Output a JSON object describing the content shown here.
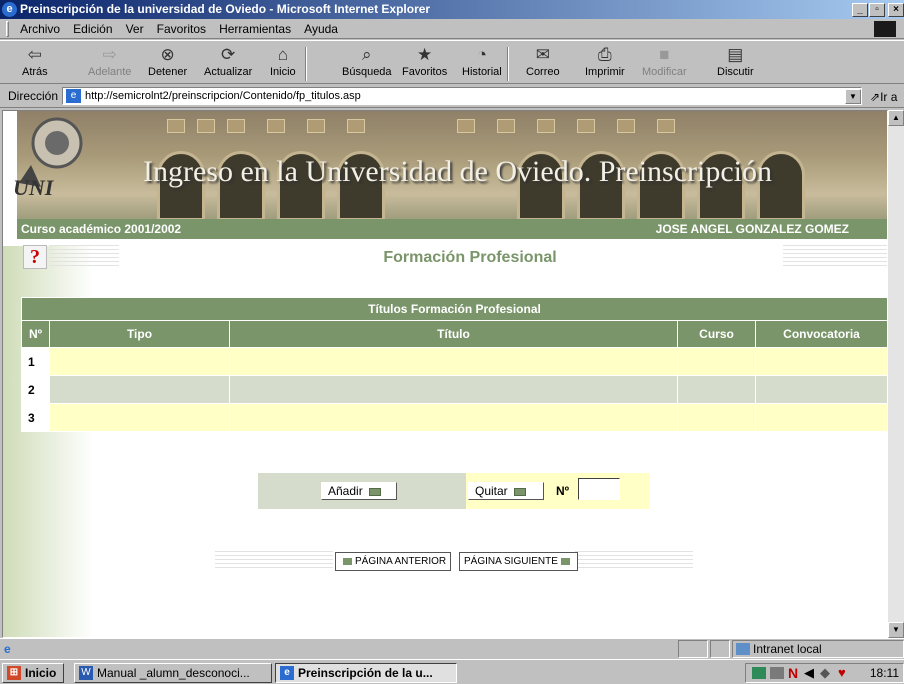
{
  "window": {
    "title": "Preinscripción de la universidad de Oviedo - Microsoft Internet Explorer"
  },
  "menu": [
    "Archivo",
    "Edición",
    "Ver",
    "Favoritos",
    "Herramientas",
    "Ayuda"
  ],
  "toolbar": {
    "back": "Atrás",
    "forward": "Adelante",
    "stop": "Detener",
    "refresh": "Actualizar",
    "home": "Inicio",
    "search": "Búsqueda",
    "favorites": "Favoritos",
    "history": "Historial",
    "mail": "Correo",
    "print": "Imprimir",
    "edit": "Modificar",
    "discuss": "Discutir"
  },
  "address": {
    "label": "Dirección",
    "url": "http://semicrolnt2/preinscripcion/Contenido/fp_titulos.asp",
    "go": "Ir a"
  },
  "banner": {
    "title": "Ingreso en la Universidad de Oviedo. Preinscripción",
    "course": "Curso académico 2001/2002",
    "user": "JOSE ANGEL GONZALEZ GOMEZ"
  },
  "section": {
    "title": "Formación Profesional"
  },
  "table": {
    "caption": "Títulos Formación Profesional",
    "headers": [
      "Nº",
      "Tipo",
      "Título",
      "Curso",
      "Convocatoria"
    ],
    "rows": [
      {
        "n": "1"
      },
      {
        "n": "2"
      },
      {
        "n": "3"
      }
    ]
  },
  "actions": {
    "add": "Añadir",
    "remove": "Quitar",
    "num_label": "Nº",
    "num_value": ""
  },
  "nav": {
    "prev": "PÁGINA ANTERIOR",
    "next": "PÁGINA SIGUIENTE"
  },
  "status": {
    "zone": "Intranet local"
  },
  "taskbar": {
    "start": "Inicio",
    "tasks": [
      "Manual _alumn_desconoci...",
      "Preinscripción de la u..."
    ],
    "clock": "18:11"
  }
}
